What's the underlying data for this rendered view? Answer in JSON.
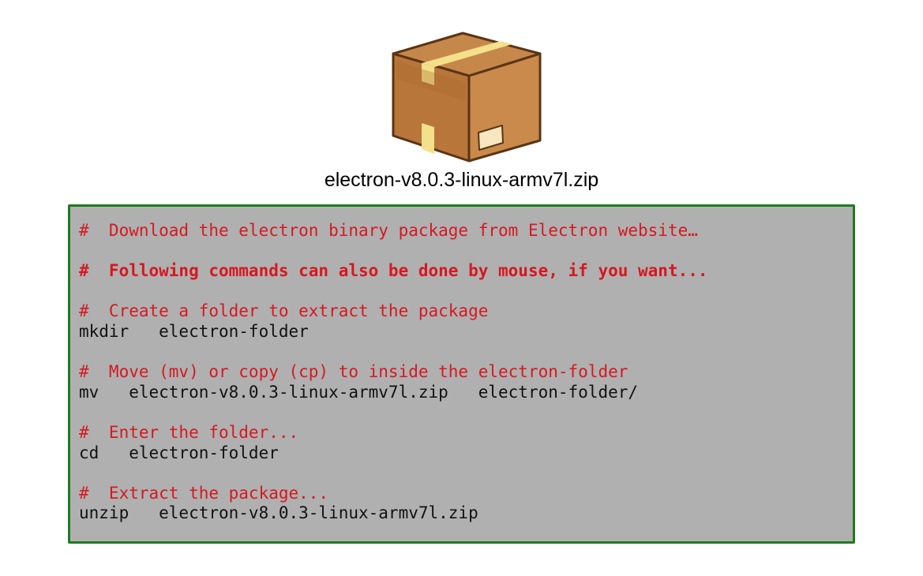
{
  "icon": "package-box-icon",
  "colors": {
    "panel_background": "#b0b0b0",
    "panel_border": "#207a20",
    "comment_text": "#d61820",
    "command_text": "#111111"
  },
  "file_name": "electron-v8.0.3-linux-armv7l.zip",
  "lines": [
    {
      "kind": "comment",
      "text": "#  Download the electron binary package from Electron website…"
    },
    {
      "kind": "blank",
      "text": ""
    },
    {
      "kind": "comment-bold",
      "text": "#  Following commands can also be done by mouse, if you want..."
    },
    {
      "kind": "blank",
      "text": ""
    },
    {
      "kind": "comment",
      "text": "#  Create a folder to extract the package"
    },
    {
      "kind": "command",
      "text": "mkdir   electron-folder"
    },
    {
      "kind": "blank",
      "text": ""
    },
    {
      "kind": "comment",
      "text": "#  Move (mv) or copy (cp) to inside the electron-folder"
    },
    {
      "kind": "command",
      "text": "mv   electron-v8.0.3-linux-armv7l.zip   electron-folder/"
    },
    {
      "kind": "blank",
      "text": ""
    },
    {
      "kind": "comment",
      "text": "#  Enter the folder..."
    },
    {
      "kind": "command",
      "text": "cd   electron-folder"
    },
    {
      "kind": "blank",
      "text": ""
    },
    {
      "kind": "comment",
      "text": "#  Extract the package..."
    },
    {
      "kind": "command",
      "text": "unzip   electron-v8.0.3-linux-armv7l.zip"
    }
  ]
}
